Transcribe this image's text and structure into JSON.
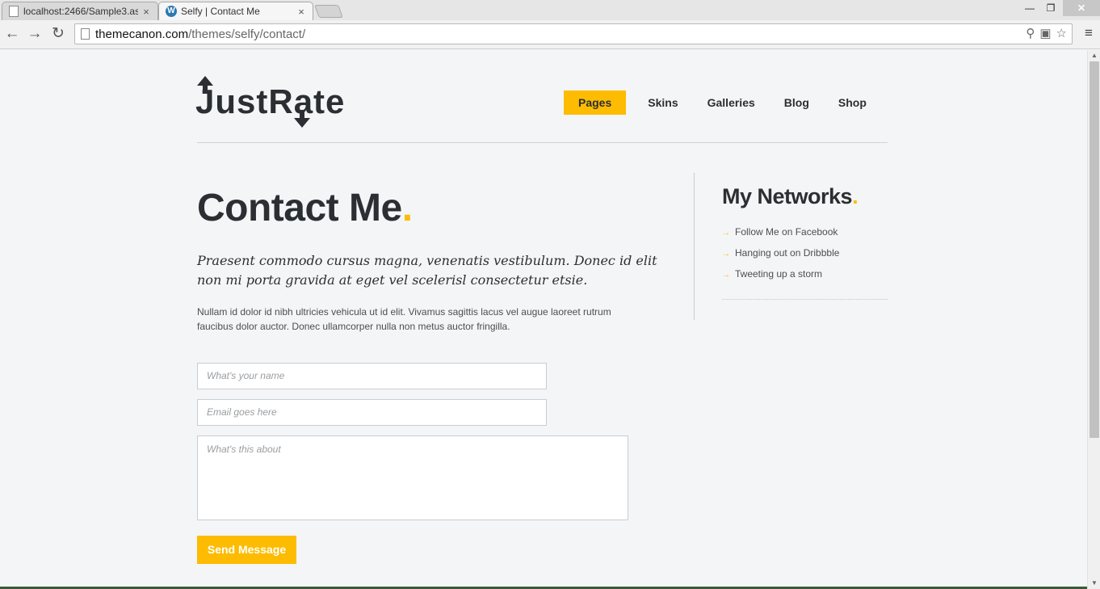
{
  "browser": {
    "tabs": [
      {
        "title": "localhost:2466/Sample3.as"
      },
      {
        "title": "Selfy | Contact Me"
      }
    ],
    "url_host": "themecanon.com",
    "url_path": "/themes/selfy/contact/"
  },
  "site": {
    "logo_text": "JustRate",
    "nav": [
      {
        "label": "Pages"
      },
      {
        "label": "Skins"
      },
      {
        "label": "Galleries"
      },
      {
        "label": "Blog"
      },
      {
        "label": "Shop"
      }
    ],
    "active_nav": "Pages",
    "accent_color": "#fdbc01"
  },
  "main": {
    "title": "Contact Me",
    "title_dot": ".",
    "lead": "Praesent commodo cursus magna, venenatis vestibulum. Donec id elit non mi porta gravida at eget vel scelerisl consectetur etsie.",
    "body": "Nullam id dolor id nibh ultricies vehicula ut id elit. Vivamus sagittis lacus vel augue laoreet rutrum faucibus dolor auctor. Donec ullamcorper nulla non metus auctor fringilla.",
    "form": {
      "name_placeholder": "What's your name",
      "email_placeholder": "Email goes here",
      "message_placeholder": "What's this about",
      "submit_label": "Send Message"
    }
  },
  "sidebar": {
    "title": "My Networks",
    "title_dot": ".",
    "links": [
      {
        "label": "Follow Me on Facebook"
      },
      {
        "label": "Hanging out on Dribbble"
      },
      {
        "label": "Tweeting up a storm"
      }
    ]
  }
}
